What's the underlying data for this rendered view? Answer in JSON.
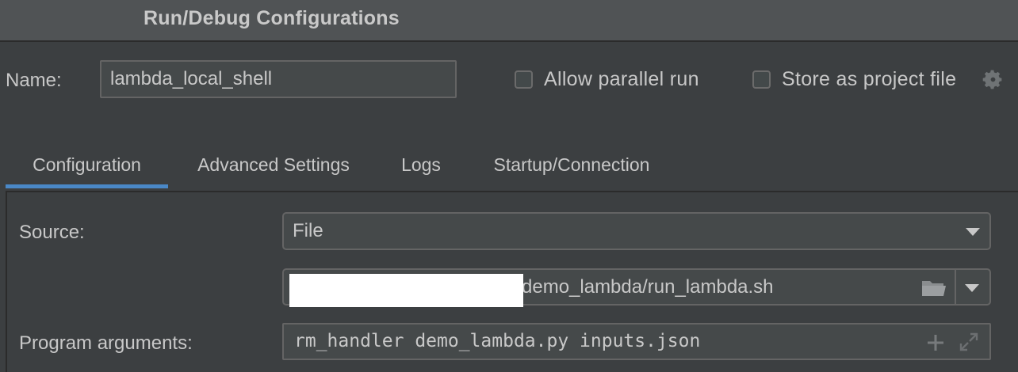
{
  "window": {
    "title": "Run/Debug Configurations"
  },
  "name_field": {
    "label": "Name:",
    "value": "lambda_local_shell"
  },
  "options": {
    "allow_parallel_run": {
      "label": "Allow parallel run",
      "checked": false
    },
    "store_as_project_file": {
      "label": "Store as project file",
      "checked": false
    },
    "settings_icon": "gear-icon"
  },
  "tabs": [
    {
      "label": "Configuration",
      "active": true
    },
    {
      "label": "Advanced Settings",
      "active": false
    },
    {
      "label": "Logs",
      "active": false
    },
    {
      "label": "Startup/Connection",
      "active": false
    }
  ],
  "configuration": {
    "source": {
      "label": "Source:",
      "value": "File"
    },
    "script_path": {
      "value": "demo_lambda/run_lambda.sh",
      "browse_icon": "folder-icon",
      "dropdown_icon": "chevron-down-icon"
    },
    "program_arguments": {
      "label": "Program arguments:",
      "value": "rm_handler demo_lambda.py inputs.json",
      "add_icon": "plus-icon",
      "expand_icon": "expand-icon"
    }
  },
  "colors": {
    "accent": "#4a88c7",
    "background": "#3c3f41",
    "titlebar": "#505355",
    "field": "#45494a",
    "border": "#646464"
  }
}
